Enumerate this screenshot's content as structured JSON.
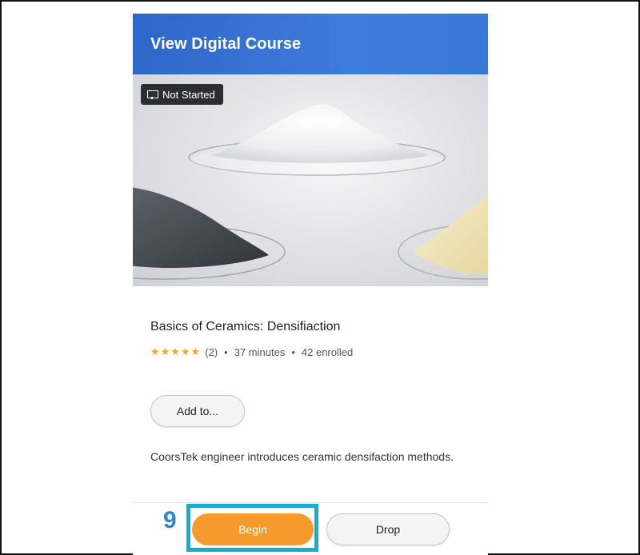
{
  "header": {
    "title": "View Digital Course"
  },
  "hero": {
    "badge_label": "Not Started",
    "badge_icon": "presentation-icon",
    "image": "ceramic-powders-on-glass-dishes"
  },
  "course": {
    "title": "Basics of Ceramics: Densifiaction",
    "rating_stars": 5,
    "rating_count": "(2)",
    "duration": "37 minutes",
    "enrolled": "42 enrolled",
    "description": "CoorsTek engineer introduces ceramic densifaction methods."
  },
  "actions": {
    "add_label": "Add to...",
    "begin_label": "Begin",
    "drop_label": "Drop"
  },
  "annotation": {
    "step_number": "9"
  },
  "colors": {
    "header_blue": "#3a74d4",
    "begin_orange": "#f79a2d",
    "star_gold": "#f6a623",
    "highlight_cyan": "#16aad4",
    "step_blue": "#2c86c7"
  }
}
